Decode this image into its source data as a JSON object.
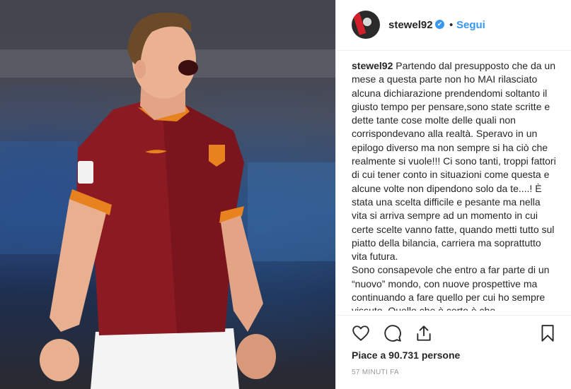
{
  "post": {
    "username": "stewel92",
    "verified_symbol": "✔",
    "separator": "•",
    "follow_label": "Segui",
    "caption_username": "stewel92",
    "caption_paragraphs": [
      "Partendo dal presupposto che da un mese a questa parte non ho MAI rilasciato alcuna dichiarazione prendendomi soltanto il giusto tempo per pensare,sono state scritte e dette tante cose molte delle quali non corrispondevano alla realtà. Speravo in un epilogo diverso ma non sempre si ha ciò che realmente si vuole!!! Ci sono tanti, troppi fattori di cui tener conto in situazioni come questa e alcune volte non dipendono solo da te....! È stata una scelta difficile e pesante ma nella vita si arriva sempre ad un momento in cui certe scelte vanno fatte, quando metti tutto sul piatto della bilancia, carriera ma soprattutto vita futura.",
      "Sono consapevole che entro a far parte di un “nuovo” mondo, con nuove prospettive ma continuando a fare quello per cui ho sempre vissuto. Quello che è certo è che"
    ],
    "likes_text": "Piace a 90.731 persone",
    "time_ago": "57 MINUTI FA"
  },
  "icons": {
    "like": "heart-icon",
    "comment": "comment-icon",
    "share": "share-icon",
    "save": "bookmark-icon"
  },
  "colors": {
    "link_blue": "#3897f0",
    "text": "#262626",
    "muted": "#999999",
    "jersey": "#8b1a22",
    "trim": "#e8821e"
  }
}
